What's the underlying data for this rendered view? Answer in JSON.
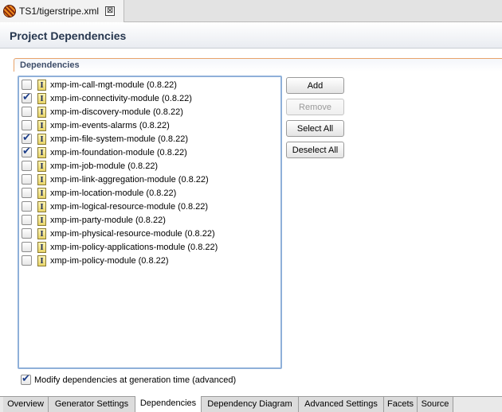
{
  "editor": {
    "tab_label": "TS1/tigerstripe.xml",
    "close_glyph": "⊠"
  },
  "page_title": "Project Dependencies",
  "section_title": "Dependencies",
  "dependencies": [
    {
      "label": "xmp-im-call-mgt-module (0.8.22)",
      "checked": false
    },
    {
      "label": "xmp-im-connectivity-module (0.8.22)",
      "checked": true
    },
    {
      "label": "xmp-im-discovery-module (0.8.22)",
      "checked": false
    },
    {
      "label": "xmp-im-events-alarms (0.8.22)",
      "checked": false
    },
    {
      "label": "xmp-im-file-system-module (0.8.22)",
      "checked": true
    },
    {
      "label": "xmp-im-foundation-module (0.8.22)",
      "checked": true
    },
    {
      "label": "xmp-im-job-module (0.8.22)",
      "checked": false
    },
    {
      "label": "xmp-im-link-aggregation-module (0.8.22)",
      "checked": false
    },
    {
      "label": "xmp-im-location-module (0.8.22)",
      "checked": false
    },
    {
      "label": "xmp-im-logical-resource-module (0.8.22)",
      "checked": false
    },
    {
      "label": "xmp-im-party-module (0.8.22)",
      "checked": false
    },
    {
      "label": "xmp-im-physical-resource-module (0.8.22)",
      "checked": false
    },
    {
      "label": "xmp-im-policy-applications-module (0.8.22)",
      "checked": false
    },
    {
      "label": "xmp-im-policy-module (0.8.22)",
      "checked": false
    }
  ],
  "module_icon_glyph": "I",
  "buttons": {
    "add": "Add",
    "remove": "Remove",
    "select_all": "Select All",
    "deselect_all": "Deselect All"
  },
  "modify_option": {
    "label": "Modify dependencies at generation time (advanced)",
    "checked": true
  },
  "page_tabs": [
    {
      "label": "Overview",
      "active": false
    },
    {
      "label": "Generator Settings",
      "active": false
    },
    {
      "label": "Dependencies",
      "active": true
    },
    {
      "label": "Dependency Diagram",
      "active": false
    },
    {
      "label": "Advanced Settings",
      "active": false
    },
    {
      "label": "Facets",
      "active": false
    },
    {
      "label": "Source",
      "active": false
    }
  ],
  "colors": {
    "title_text": "#26364e",
    "section_border": "#e8a36a",
    "list_focus_border": "#8fb0d9"
  }
}
